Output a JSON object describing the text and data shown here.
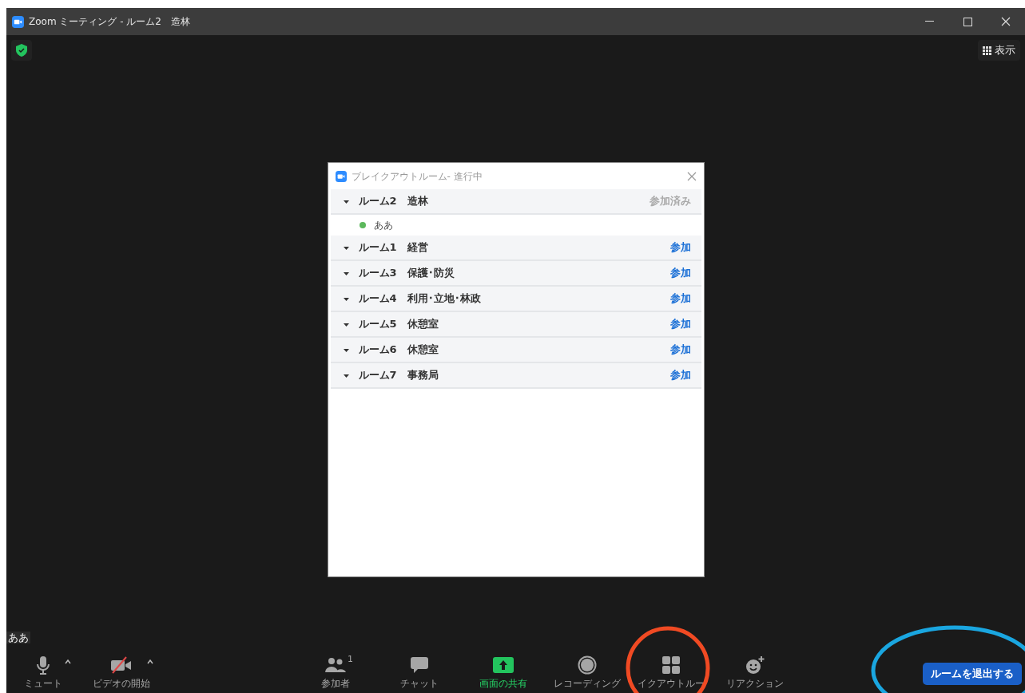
{
  "window": {
    "title": "Zoom ミーティング - ルーム2　造林"
  },
  "view_button": {
    "label": "表示"
  },
  "dialog": {
    "title": "ブレイクアウトルーム- 進行中",
    "rooms": [
      {
        "name": "ルーム2　造林",
        "expanded": true,
        "action": "参加済み",
        "joined": true,
        "members": [
          {
            "name": "ああ",
            "color": "#5cb85c"
          }
        ]
      },
      {
        "name": "ルーム1　経営",
        "expanded": true,
        "action": "参加",
        "joined": false
      },
      {
        "name": "ルーム3　保護･防災",
        "expanded": true,
        "action": "参加",
        "joined": false
      },
      {
        "name": "ルーム4　利用･立地･林政",
        "expanded": true,
        "action": "参加",
        "joined": false
      },
      {
        "name": "ルーム5　休憩室",
        "expanded": true,
        "action": "参加",
        "joined": false
      },
      {
        "name": "ルーム6　休憩室",
        "expanded": true,
        "action": "参加",
        "joined": false
      },
      {
        "name": "ルーム7　事務局",
        "expanded": true,
        "action": "参加",
        "joined": false
      }
    ]
  },
  "name_tag": "ああ",
  "toolbar": {
    "left": [
      {
        "kind": "mic",
        "label": "ミュート",
        "caret": true
      },
      {
        "kind": "video-off",
        "label": "ビデオの開始",
        "caret": true
      }
    ],
    "center": [
      {
        "kind": "participants",
        "label": "参加者",
        "count": "1"
      },
      {
        "kind": "chat",
        "label": "チャット"
      },
      {
        "kind": "share",
        "label": "画面の共有"
      },
      {
        "kind": "record",
        "label": "レコーディング"
      },
      {
        "kind": "breakout",
        "label": "イクアウトルー"
      },
      {
        "kind": "reaction",
        "label": "リアクション"
      }
    ],
    "leave_button": "ルームを退出する"
  },
  "annotations": [
    {
      "kind": "circle",
      "color": "#f04a23"
    },
    {
      "kind": "ellipse",
      "color": "#1aa6e0"
    }
  ]
}
